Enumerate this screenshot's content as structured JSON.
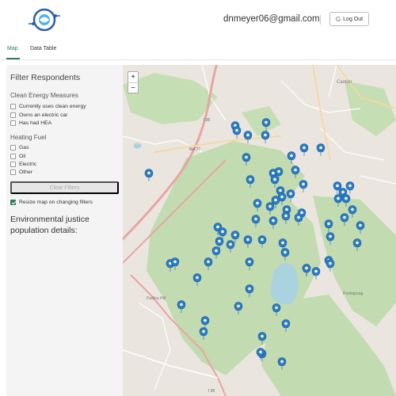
{
  "header": {
    "logo_icon": "leaf-circle-logo-icon",
    "user_email": "dnmeyer06@gmail.com",
    "logout_label": "Log Out",
    "logout_icon": "google-g-icon"
  },
  "tabs": [
    {
      "label": "Map",
      "active": true
    },
    {
      "label": "Data Table",
      "active": false
    }
  ],
  "sidebar": {
    "title": "Filter Respondents",
    "clean_energy": {
      "heading": "Clean Energy Measures",
      "options": [
        "Currently uses clean energy",
        "Owns an electric car",
        "Has had HEA"
      ]
    },
    "heating_fuel": {
      "heading": "Heating Fuel",
      "options": [
        "Gas",
        "Oil",
        "Electric",
        "Other"
      ]
    },
    "clear_filters_label": "Clear Filters",
    "resize_label": "Resize map on changing filters",
    "resize_checked": true,
    "ej_title": "Environmental justice population details:"
  },
  "map": {
    "zoom_in": "+",
    "zoom_out": "−",
    "labels": [
      "I 95",
      "I 95",
      "MA 27",
      "Canton",
      "Dudley Hill",
      "Ponkapoag"
    ],
    "accent_color": "#2e7d5b",
    "marker_color": "#2a7cc7",
    "marker_icon": "map-pin-icon"
  }
}
